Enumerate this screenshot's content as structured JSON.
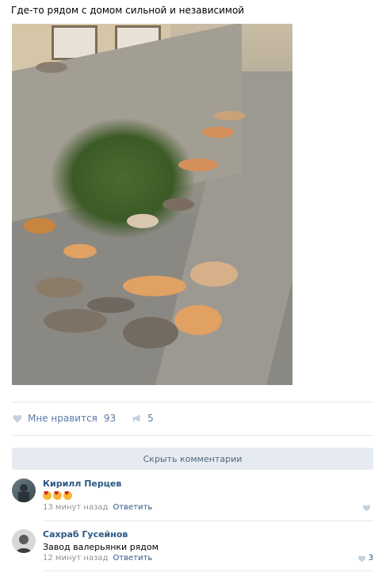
{
  "post": {
    "text": "Где-то рядом с домом сильной и независимой"
  },
  "actions": {
    "like_label": "Мне нравится",
    "like_count": "93",
    "share_count": "5"
  },
  "comments_toggle": "Скрыть комментарии",
  "comments": [
    {
      "author": "Кирилл Перцев",
      "text": "",
      "emoji_count": 3,
      "time": "13 минут назад",
      "reply": "Ответить",
      "likes": ""
    },
    {
      "author": "Сахраб Гусейнов",
      "text": "Завод валерьянки рядом",
      "time": "12 минут назад",
      "reply": "Ответить",
      "likes": "3"
    }
  ],
  "colors": {
    "link": "#2a5885",
    "like": "#5b7ba6",
    "button_bg": "#e5ebf1"
  }
}
